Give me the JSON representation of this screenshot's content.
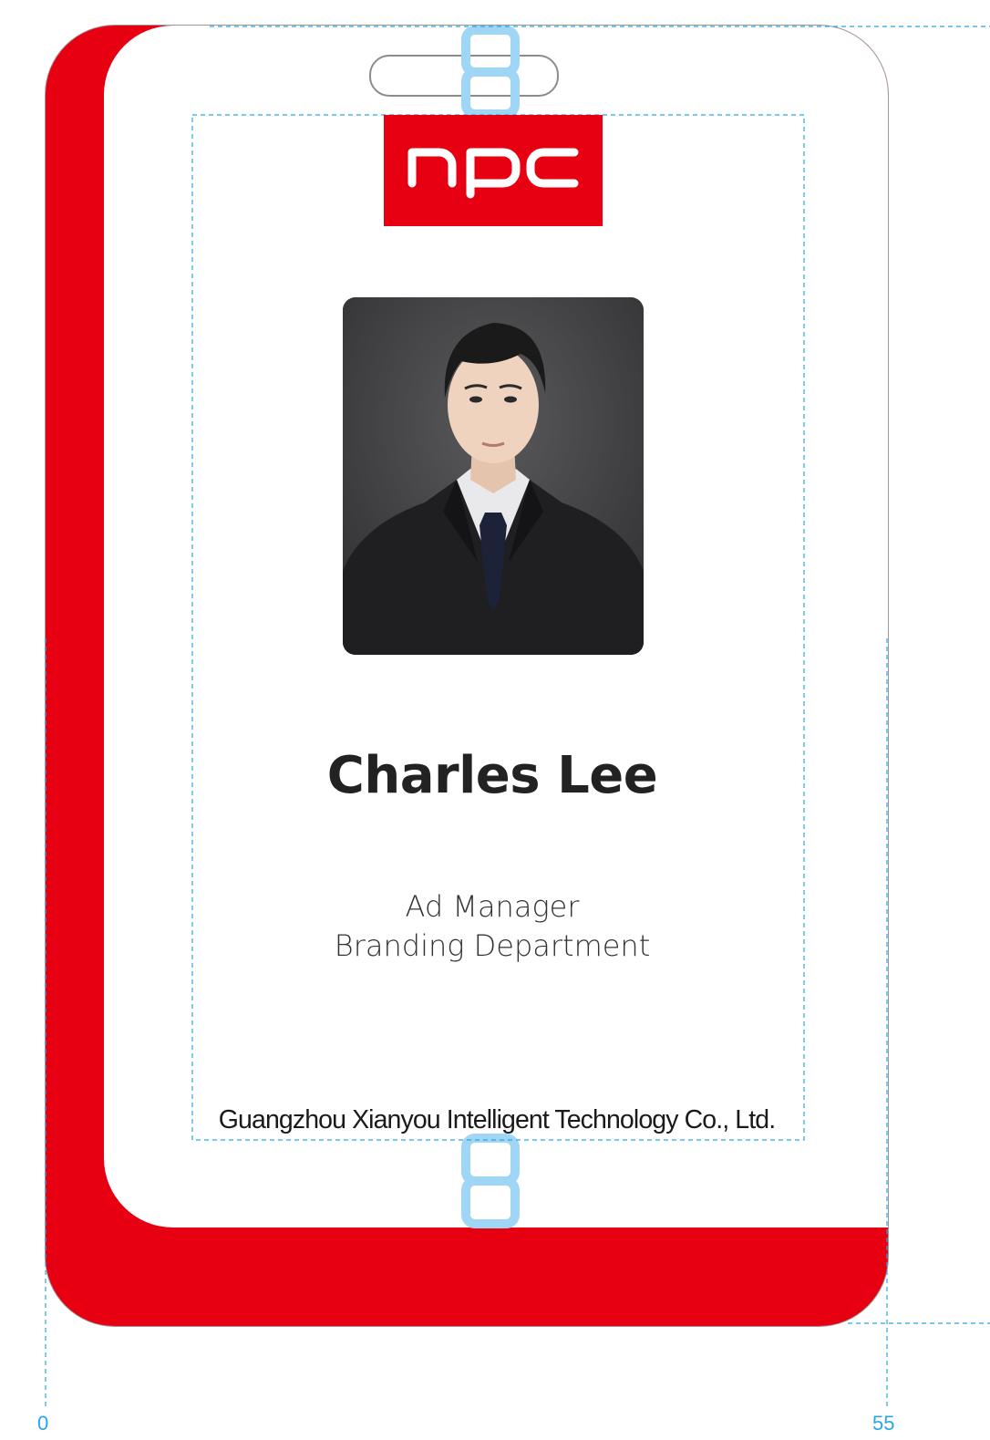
{
  "badge": {
    "logo_text": "npc",
    "name": "Charles Lee",
    "position": "Ad Manager",
    "department": "Branding Department",
    "company": "Guangzhou Xianyou Intelligent Technology Co., Ltd."
  },
  "dimension_labels": {
    "left": "0",
    "right": "55"
  },
  "colors": {
    "brand_red": "#e60012",
    "guide_blue": "#2aa5e6",
    "clip_blue": "#9fd6f5"
  },
  "icons": {
    "logo": "npc-logo-icon",
    "photo": "portrait-photo"
  }
}
